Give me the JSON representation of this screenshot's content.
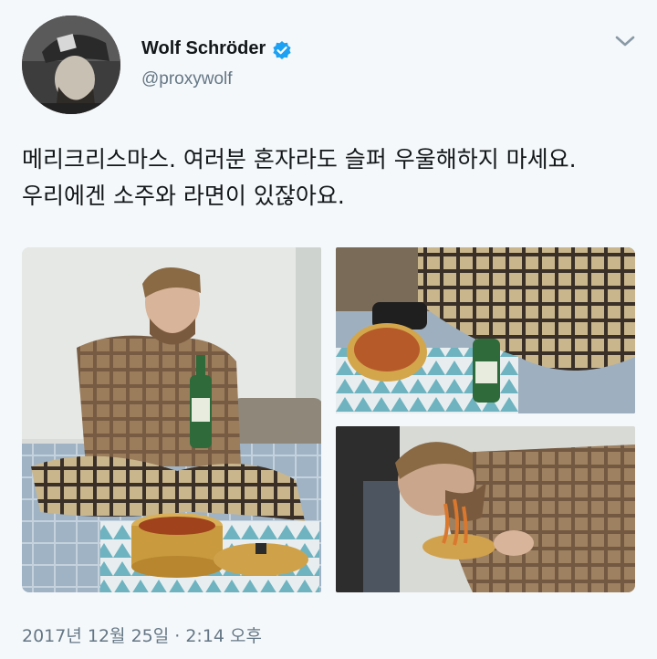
{
  "author": {
    "name": "Wolf Schröder",
    "handle": "@proxywolf",
    "verified": true
  },
  "icons": {
    "verified": "verified-badge-icon",
    "menu": "chevron-down-icon"
  },
  "tweet": {
    "lines": [
      "메리크리스마스. 여러분 혼자라도 슬퍼 우울해하지 마세요.",
      "우리에겐 소주와 라면이 있잖아요."
    ],
    "timestamp": "2017년 12월 25일 · 2:14 오후"
  },
  "colors": {
    "text": "#14171a",
    "secondary": "#657786",
    "verified_blue": "#1da1f2",
    "background": "#f5f8fa"
  }
}
